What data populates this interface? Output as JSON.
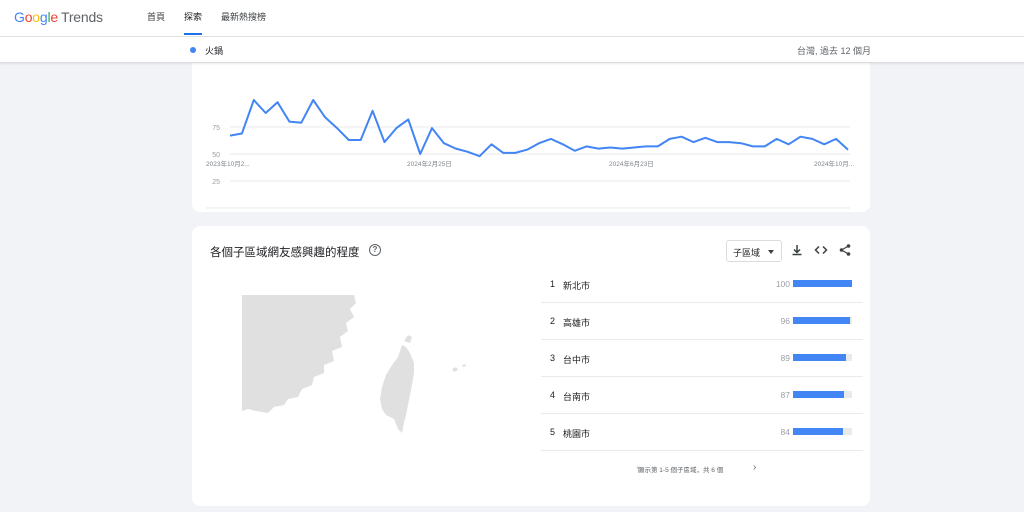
{
  "logo": {
    "letters": [
      "G",
      "o",
      "o",
      "g",
      "l",
      "e"
    ],
    "product": "Trends"
  },
  "nav": [
    {
      "label": "首頁",
      "active": false
    },
    {
      "label": "探索",
      "active": true
    },
    {
      "label": "最新熱搜榜",
      "active": false
    }
  ],
  "term": {
    "label": "火鍋",
    "filter": "台灣, 過去 12 個月",
    "color": "#4285f4"
  },
  "chart_data": {
    "type": "line",
    "title": "",
    "ylabel": "",
    "xlabel": "",
    "y_ticks": [
      "75",
      "50",
      "25"
    ],
    "x_ticks": [
      "2023年10月2...",
      "2024年2月25日",
      "2024年6月23日",
      "2024年10月..."
    ],
    "series": [
      {
        "color": "#4285f4",
        "values": [
          67,
          69,
          100,
          88,
          98,
          80,
          79,
          100,
          84,
          74,
          63,
          63,
          90,
          61,
          74,
          82,
          50,
          74,
          60,
          55,
          52,
          48,
          59,
          51,
          51,
          54,
          60,
          64,
          59,
          53,
          57,
          55,
          56,
          55,
          56,
          57,
          57,
          64,
          66,
          61,
          65,
          61,
          61,
          60,
          57,
          57,
          64,
          59,
          66,
          64,
          59,
          64,
          54
        ]
      }
    ]
  },
  "region": {
    "title": "各個子區域網友感興趣的程度",
    "select_label": "子區域",
    "rows": [
      {
        "rank": "1",
        "name": "新北市",
        "value": 100
      },
      {
        "rank": "2",
        "name": "高雄市",
        "value": 96
      },
      {
        "rank": "3",
        "name": "台中市",
        "value": 89
      },
      {
        "rank": "4",
        "name": "台南市",
        "value": 87
      },
      {
        "rank": "5",
        "name": "桃園市",
        "value": 84
      }
    ],
    "pager": "顯示第 1-5 個子區域，共 6 個",
    "colors": {
      "bar": "#4285f4",
      "track": "#e8eaed",
      "map_land": "#e0e0e0"
    }
  },
  "icons": [
    "help-icon",
    "download-icon",
    "embed-icon",
    "share-icon",
    "chevron-left-icon",
    "chevron-right-icon"
  ]
}
